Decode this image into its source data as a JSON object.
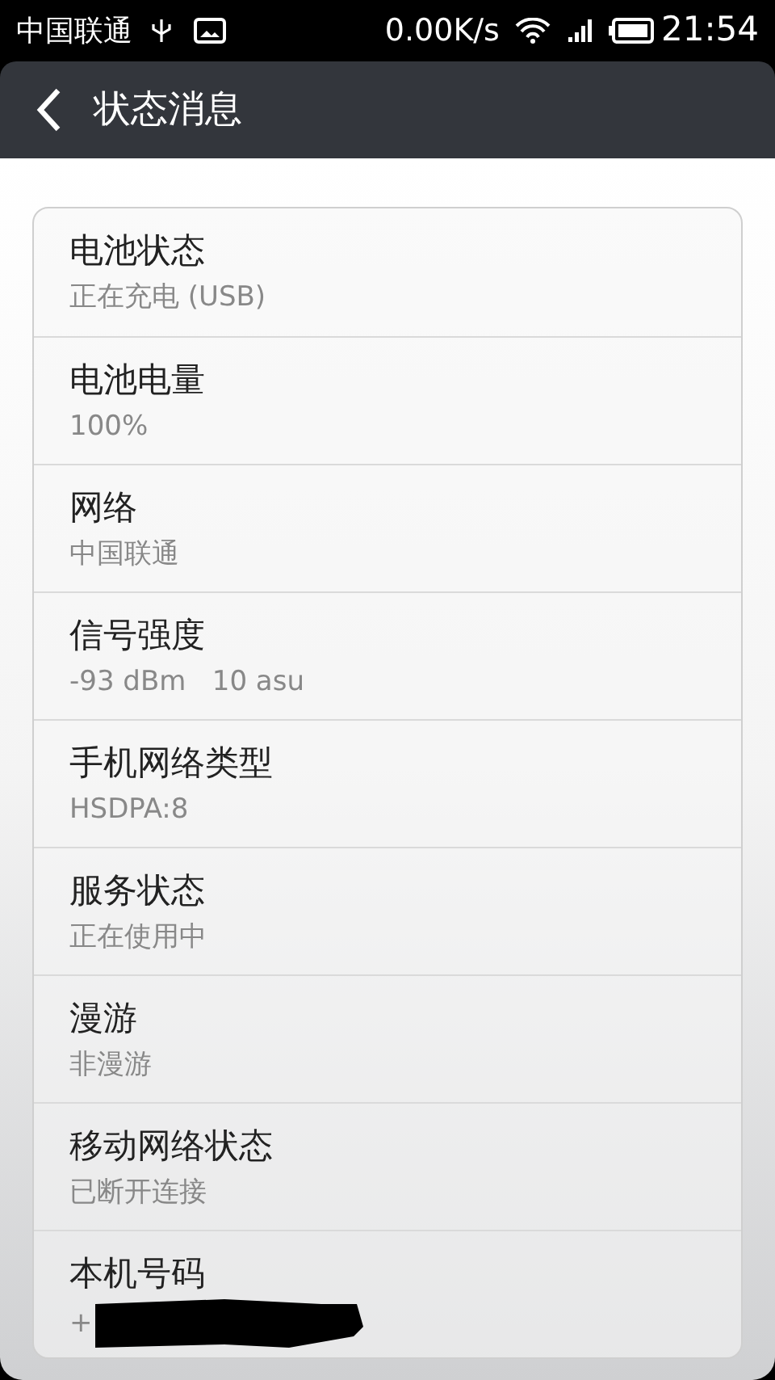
{
  "status_bar": {
    "carrier": "中国联通",
    "speed": "0.00K/s",
    "time": "21:54"
  },
  "title_bar": {
    "title": "状态消息"
  },
  "items": [
    {
      "title": "电池状态",
      "value": "正在充电 (USB)",
      "redacted": false
    },
    {
      "title": "电池电量",
      "value": "100%",
      "redacted": false
    },
    {
      "title": "网络",
      "value": "中国联通",
      "redacted": false
    },
    {
      "title": "信号强度",
      "value": "-93 dBm   10 asu",
      "redacted": false
    },
    {
      "title": "手机网络类型",
      "value": "HSDPA:8",
      "redacted": false
    },
    {
      "title": "服务状态",
      "value": "正在使用中",
      "redacted": false
    },
    {
      "title": "漫游",
      "value": "非漫游",
      "redacted": false
    },
    {
      "title": "移动网络状态",
      "value": "已断开连接",
      "redacted": false
    },
    {
      "title": "本机号码",
      "value": "+",
      "redacted": true
    }
  ]
}
